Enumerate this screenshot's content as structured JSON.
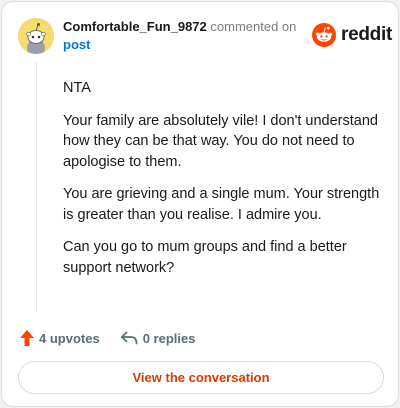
{
  "comment": {
    "username": "Comfortable_Fun_9872",
    "action_text": "commented on",
    "target_text": "post",
    "paragraphs": [
      "NTA",
      "Your family are absolutely vile! I don't understand how they can be that way. You do not need to apologise to them.",
      "You are grieving and a single mum. Your strength is greater than you realise. I admire you.",
      "Can you go to mum groups and find a better support network?"
    ]
  },
  "brand": {
    "wordmark": "reddit",
    "icon": "reddit-logo-icon",
    "color": "#ff4500"
  },
  "actions": {
    "upvotes_label": "4 upvotes",
    "replies_label": "0 replies",
    "upvote_icon": "upvote-arrow-icon",
    "reply_icon": "reply-arrow-icon",
    "upvote_color": "#ff4500"
  },
  "cta": {
    "label": "View the conversation",
    "color": "#d93a00"
  },
  "avatar": {
    "icon": "snoo-avatar-icon",
    "color": "#f5dc6e"
  }
}
